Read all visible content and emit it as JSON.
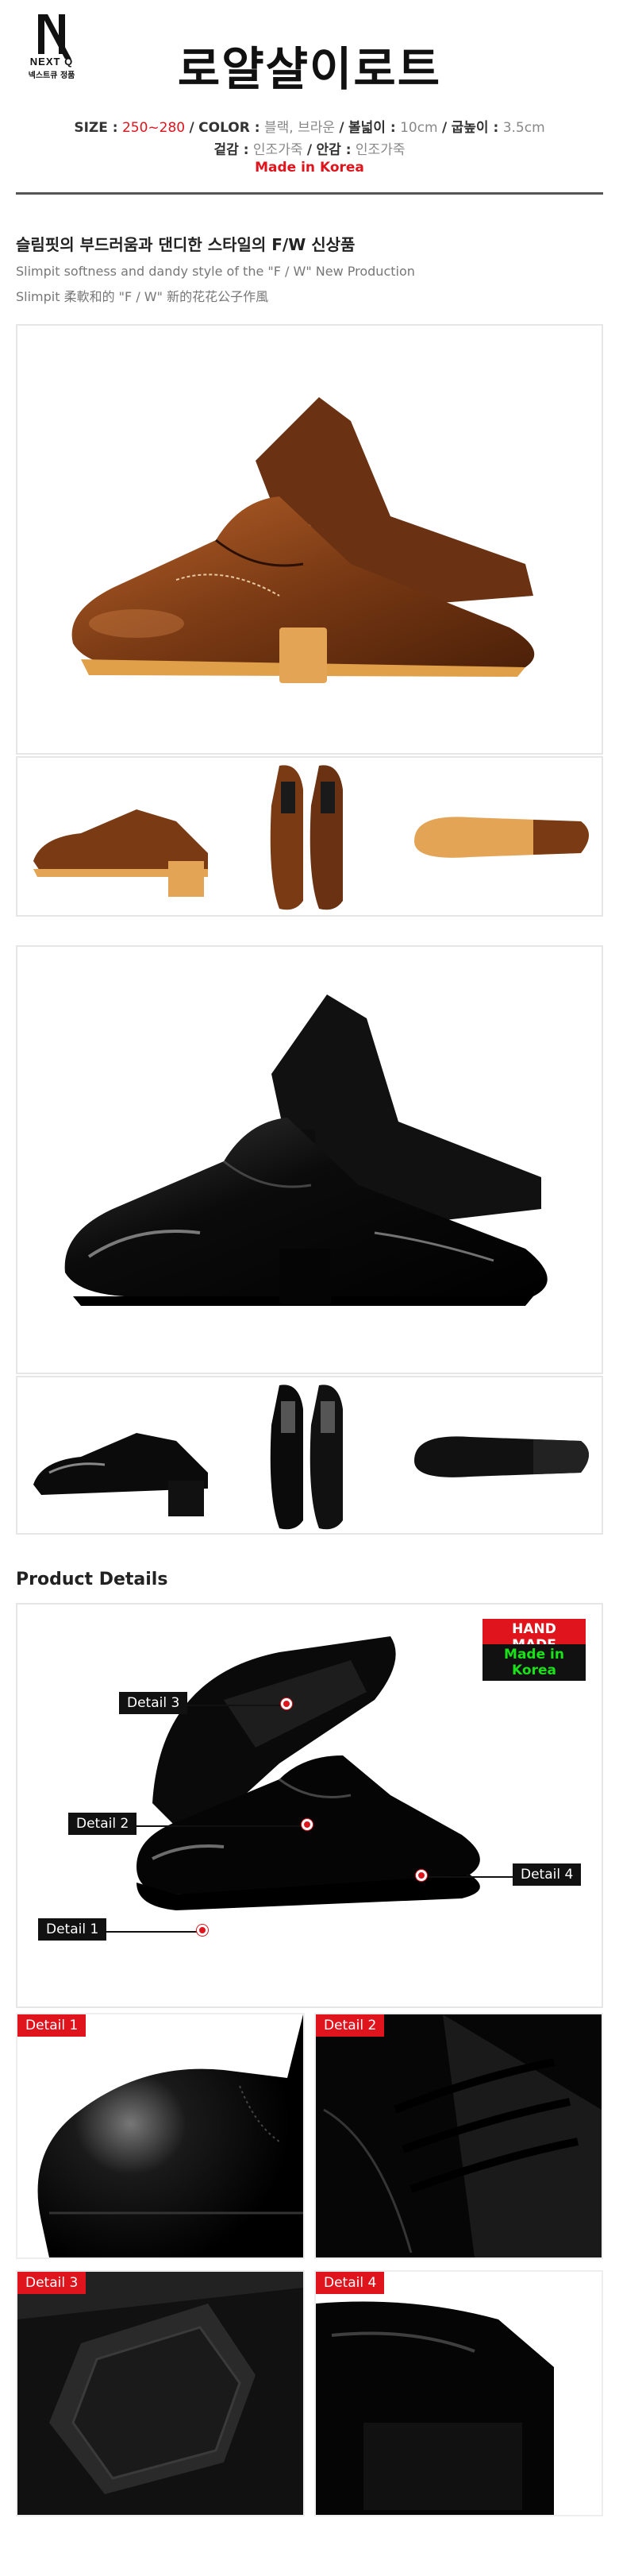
{
  "header": {
    "brand_name": "NEXT Q",
    "brand_sub": "넥스트큐 정품",
    "title": "로얄샬이로트"
  },
  "spec": {
    "size_label": "SIZE :",
    "size_value": "250~280",
    "color_label": "COLOR :",
    "color_value": "블랙, 브라운",
    "width_label": "볼넓이 :",
    "width_value": "10cm",
    "heel_label": "굽높이 :",
    "heel_value": "3.5cm",
    "sep": "/",
    "outer_label": "겉감 :",
    "outer_value": "인조가죽",
    "inner_label": "안감 :",
    "inner_value": "인조가죽",
    "origin": "Made in Korea"
  },
  "intro": {
    "headline": "슬림핏의 부드러움과 댄디한 스타일의 F/W 신상품",
    "tagline_en": "Slimpit softness and dandy style of the \"F / W\" New Production",
    "tagline_cn": "Slimpit 柔軟和的 \"F / W\" 新的花花公子作風"
  },
  "product_details": {
    "title": "Product Details",
    "badge_handmade": "HAND MADE",
    "badge_korea": "Made in Korea",
    "callouts": [
      "Detail 1",
      "Detail 2",
      "Detail 3",
      "Detail 4"
    ]
  },
  "details": [
    {
      "label": "Detail 1"
    },
    {
      "label": "Detail 2"
    },
    {
      "label": "Detail 3"
    },
    {
      "label": "Detail 4"
    }
  ],
  "colors": {
    "accent_red": "#e0141d",
    "brown": "#7a3a14",
    "black": "#0b0b0b",
    "sole_tan": "#e0a04a"
  }
}
